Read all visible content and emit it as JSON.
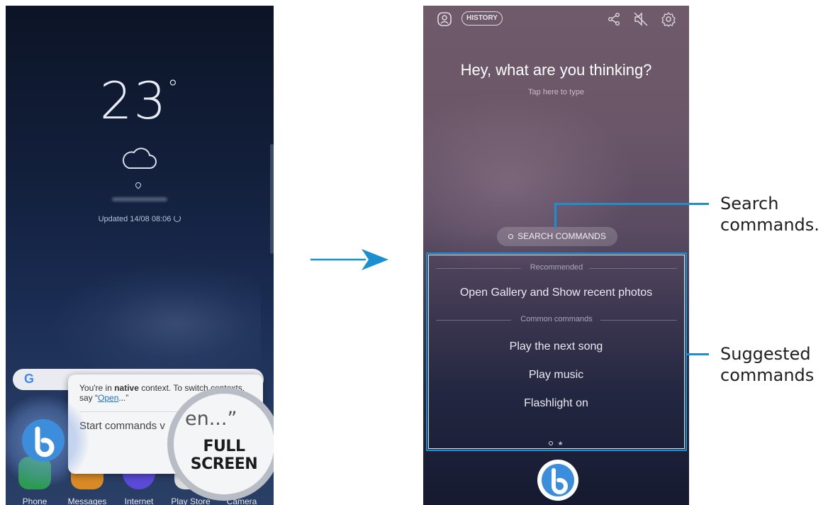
{
  "left_phone": {
    "temperature": "23",
    "degree_symbol": "°",
    "updated": "Updated 14/08 08:06",
    "google_letter": "G",
    "dock": [
      {
        "label": "Phone",
        "color": "#2d9a52",
        "icon": "phone-icon"
      },
      {
        "label": "Messages",
        "color": "#d88a25",
        "icon": "messages-icon"
      },
      {
        "label": "Internet",
        "color": "#5a4ad6",
        "icon": "internet-icon"
      },
      {
        "label": "Play Store",
        "color": "#e8e8e8",
        "icon": "play-store-icon"
      },
      {
        "label": "Camera",
        "color": "#5f6da8",
        "icon": "camera-icon"
      }
    ],
    "popup": {
      "context_prefix": "You're in ",
      "context_bold": "native",
      "context_suffix": " context. To switch contexts,",
      "say_prefix": "say “",
      "say_link": "Open",
      "say_suffix": "...”",
      "start_commands": "Start commands v"
    },
    "magnifier": {
      "listening": "en...”",
      "full_screen": "FULL SCREEN"
    }
  },
  "right_phone": {
    "history_label": "HISTORY",
    "prompt_title": "Hey, what are you thinking?",
    "prompt_hint": "Tap here to type",
    "search_commands_label": "SEARCH COMMANDS",
    "recommended_header": "Recommended",
    "recommended_command": "Open Gallery and Show recent photos",
    "common_header": "Common commands",
    "common_commands": [
      "Play the next song",
      "Play music",
      "Flashlight on"
    ],
    "page_indicator_second": "★"
  },
  "callouts": {
    "search_line1": "Search",
    "search_line2": "commands.",
    "suggested_line1": "Suggested",
    "suggested_line2": "commands"
  },
  "colors": {
    "accent_blue": "#1a8fd2",
    "bixby_blue": "#3c8edc"
  }
}
